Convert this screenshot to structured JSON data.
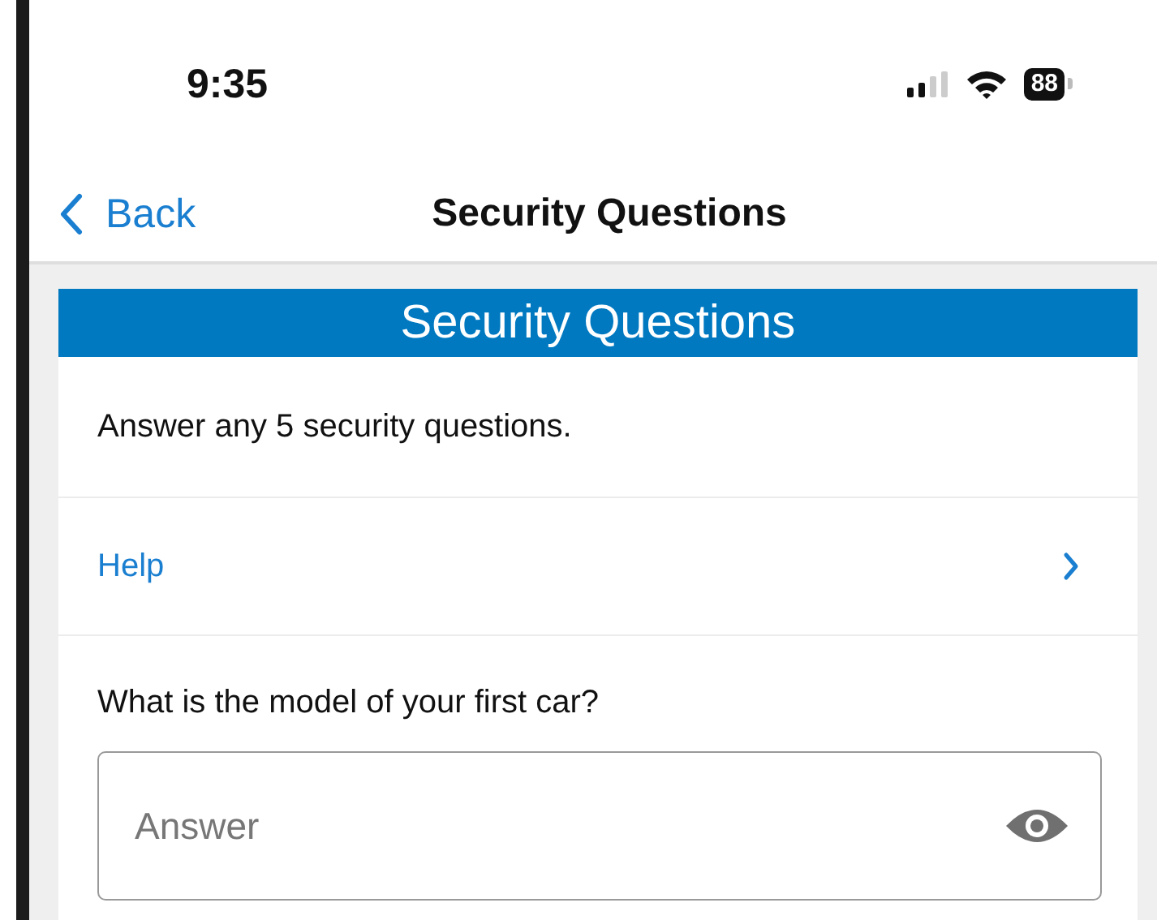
{
  "status_bar": {
    "time": "9:35",
    "battery": "88"
  },
  "nav": {
    "back": "Back",
    "title": "Security Questions"
  },
  "card": {
    "header": "Security Questions",
    "intro": "Answer any 5 security questions.",
    "help": "Help",
    "question": {
      "label": "What is the model of your first car?",
      "placeholder": "Answer"
    }
  }
}
